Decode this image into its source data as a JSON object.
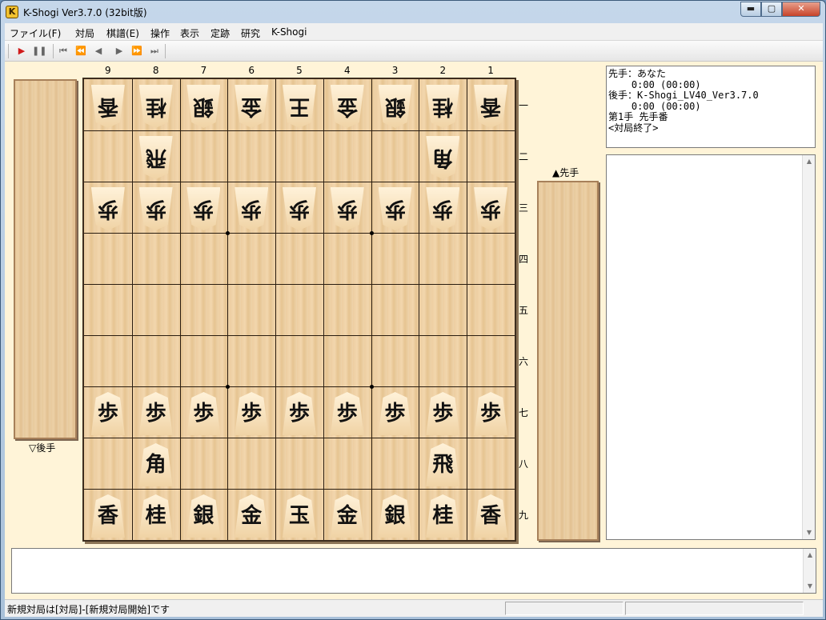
{
  "window": {
    "title": "K-Shogi Ver3.7.0 (32bit版)",
    "icon_letter": "K",
    "min_glyph": "▬",
    "max_glyph": "▢",
    "close_glyph": "✕"
  },
  "menu": [
    "ファイル(F)",
    "対局",
    "棋譜(E)",
    "操作",
    "表示",
    "定跡",
    "研究",
    "K-Shogi"
  ],
  "toolbar": [
    {
      "name": "play-icon",
      "glyph": "▶",
      "color": "#d01a1a"
    },
    {
      "name": "pause-icon",
      "glyph": "❚❚",
      "color": "#666666"
    },
    {
      "name": "first-move-icon",
      "glyph": "⏮",
      "color": "#666666"
    },
    {
      "name": "fast-back-icon",
      "glyph": "⏪",
      "color": "#666666"
    },
    {
      "name": "step-back-icon",
      "glyph": "◀",
      "color": "#666666"
    },
    {
      "name": "step-forward-icon",
      "glyph": "▶",
      "color": "#666666"
    },
    {
      "name": "fast-forward-icon",
      "glyph": "⏩",
      "color": "#666666"
    },
    {
      "name": "last-move-icon",
      "glyph": "⏭",
      "color": "#666666"
    }
  ],
  "board": {
    "file_labels": [
      "9",
      "8",
      "7",
      "6",
      "5",
      "4",
      "3",
      "2",
      "1"
    ],
    "rank_labels": [
      "一",
      "二",
      "三",
      "四",
      "五",
      "六",
      "七",
      "八",
      "九"
    ],
    "pieces": [
      {
        "file": 9,
        "rank": 1,
        "char": "香",
        "side": "gote"
      },
      {
        "file": 8,
        "rank": 1,
        "char": "桂",
        "side": "gote"
      },
      {
        "file": 7,
        "rank": 1,
        "char": "銀",
        "side": "gote"
      },
      {
        "file": 6,
        "rank": 1,
        "char": "金",
        "side": "gote"
      },
      {
        "file": 5,
        "rank": 1,
        "char": "王",
        "side": "gote"
      },
      {
        "file": 4,
        "rank": 1,
        "char": "金",
        "side": "gote"
      },
      {
        "file": 3,
        "rank": 1,
        "char": "銀",
        "side": "gote"
      },
      {
        "file": 2,
        "rank": 1,
        "char": "桂",
        "side": "gote"
      },
      {
        "file": 1,
        "rank": 1,
        "char": "香",
        "side": "gote"
      },
      {
        "file": 8,
        "rank": 2,
        "char": "飛",
        "side": "gote"
      },
      {
        "file": 2,
        "rank": 2,
        "char": "角",
        "side": "gote"
      },
      {
        "file": 9,
        "rank": 3,
        "char": "歩",
        "side": "gote"
      },
      {
        "file": 8,
        "rank": 3,
        "char": "歩",
        "side": "gote"
      },
      {
        "file": 7,
        "rank": 3,
        "char": "歩",
        "side": "gote"
      },
      {
        "file": 6,
        "rank": 3,
        "char": "歩",
        "side": "gote"
      },
      {
        "file": 5,
        "rank": 3,
        "char": "歩",
        "side": "gote"
      },
      {
        "file": 4,
        "rank": 3,
        "char": "歩",
        "side": "gote"
      },
      {
        "file": 3,
        "rank": 3,
        "char": "歩",
        "side": "gote"
      },
      {
        "file": 2,
        "rank": 3,
        "char": "歩",
        "side": "gote"
      },
      {
        "file": 1,
        "rank": 3,
        "char": "歩",
        "side": "gote"
      },
      {
        "file": 9,
        "rank": 7,
        "char": "歩",
        "side": "sente"
      },
      {
        "file": 8,
        "rank": 7,
        "char": "歩",
        "side": "sente"
      },
      {
        "file": 7,
        "rank": 7,
        "char": "歩",
        "side": "sente"
      },
      {
        "file": 6,
        "rank": 7,
        "char": "歩",
        "side": "sente"
      },
      {
        "file": 5,
        "rank": 7,
        "char": "歩",
        "side": "sente"
      },
      {
        "file": 4,
        "rank": 7,
        "char": "歩",
        "side": "sente"
      },
      {
        "file": 3,
        "rank": 7,
        "char": "歩",
        "side": "sente"
      },
      {
        "file": 2,
        "rank": 7,
        "char": "歩",
        "side": "sente"
      },
      {
        "file": 1,
        "rank": 7,
        "char": "歩",
        "side": "sente"
      },
      {
        "file": 8,
        "rank": 8,
        "char": "角",
        "side": "sente"
      },
      {
        "file": 2,
        "rank": 8,
        "char": "飛",
        "side": "sente"
      },
      {
        "file": 9,
        "rank": 9,
        "char": "香",
        "side": "sente"
      },
      {
        "file": 8,
        "rank": 9,
        "char": "桂",
        "side": "sente"
      },
      {
        "file": 7,
        "rank": 9,
        "char": "銀",
        "side": "sente"
      },
      {
        "file": 6,
        "rank": 9,
        "char": "金",
        "side": "sente"
      },
      {
        "file": 5,
        "rank": 9,
        "char": "玉",
        "side": "sente"
      },
      {
        "file": 4,
        "rank": 9,
        "char": "金",
        "side": "sente"
      },
      {
        "file": 3,
        "rank": 9,
        "char": "銀",
        "side": "sente"
      },
      {
        "file": 2,
        "rank": 9,
        "char": "桂",
        "side": "sente"
      },
      {
        "file": 1,
        "rank": 9,
        "char": "香",
        "side": "sente"
      }
    ]
  },
  "stands": {
    "gote_label": "▽後手",
    "sente_label": "▲先手"
  },
  "info": {
    "lines": [
      "先手：あなた",
      "    0:00 (00:00)",
      "後手：K-Shogi_LV40_Ver3.7.0",
      "    0:00 (00:00)",
      "第1手 先手番",
      "<対局終了>"
    ]
  },
  "scroll": {
    "up_glyph": "▲",
    "down_glyph": "▼"
  },
  "status": {
    "text": "新規対局は[対局]-[新規対局開始]です"
  }
}
